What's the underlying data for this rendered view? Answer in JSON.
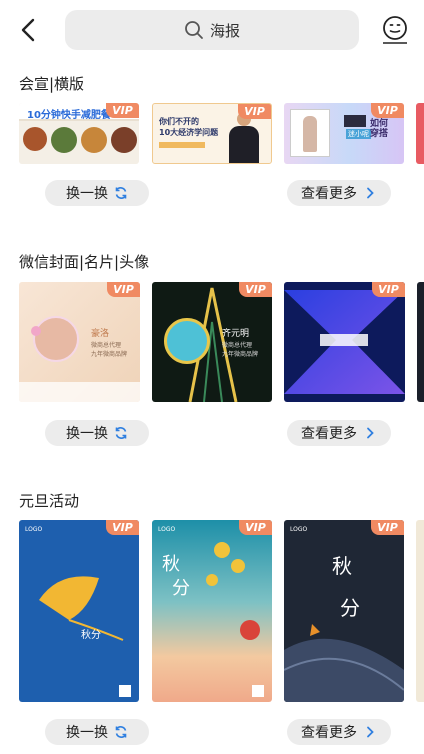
{
  "header": {
    "search_text": "海报"
  },
  "sections": [
    {
      "title": "会宣|横版",
      "swap_label": "换一换",
      "more_label": "查看更多",
      "vip_badge": "VIP",
      "cards": [
        {
          "text": "10分钟快手减肥餐"
        },
        {
          "text": "你们不开的 10大经济学问题",
          "line1": "你们不开的",
          "line2": "10大经济学问题"
        },
        {
          "text": "如何穿搭",
          "tag": "迷小呢"
        }
      ]
    },
    {
      "title": "微信封面|名片|头像",
      "swap_label": "换一换",
      "more_label": "查看更多",
      "vip_badge": "VIP",
      "cards": [
        {
          "name": "豪洛",
          "sub1": "微商总代理",
          "sub2": "九年微商品牌"
        },
        {
          "name": "齐元明",
          "sub1": "微商总代理",
          "sub2": "九年微商品牌"
        },
        {}
      ]
    },
    {
      "title": "元旦活动",
      "swap_label": "换一换",
      "more_label": "查看更多",
      "vip_badge": "VIP",
      "cards": [
        {
          "logo": "LOGO",
          "big": "秋分"
        },
        {
          "logo": "LOGO",
          "big1": "秋",
          "big2": "分"
        },
        {
          "logo": "LOGO",
          "big1": "秋",
          "big2": "分"
        }
      ]
    }
  ],
  "colors": {
    "vip": "#f08a62",
    "button_bg": "#ececec",
    "refresh_icon": "#2f7fe0"
  }
}
